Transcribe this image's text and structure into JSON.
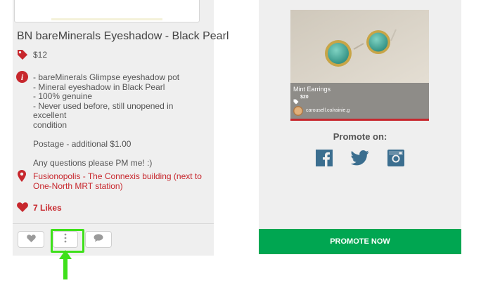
{
  "listing": {
    "title": "BN bareMinerals Eyeshadow - Black Pearl",
    "price": "$12",
    "description_lines": [
      "- bareMinerals Glimpse eyeshadow pot",
      "- Mineral eyeshadow in Black Pearl",
      "- 100% genuine",
      "- Never used before, still unopened in excellent",
      "condition",
      "",
      "Postage - additional $1.00",
      "",
      "Any questions please PM me! :)"
    ],
    "location_lines": [
      "Fusionopolis - The Connexis building (next to",
      "One-North MRT station)"
    ],
    "likes": "7 Likes"
  },
  "promo_card": {
    "item_name": "Mint Earrings",
    "price": "$20",
    "seller": "carousell.co/rainie.g"
  },
  "promote": {
    "heading": "Promote on:",
    "button_label": "PROMOTE NOW"
  },
  "colors": {
    "accent_red": "#c7272d",
    "promote_green": "#00a651",
    "highlight_green": "#3ee01a",
    "social_blue": "#3b6e8f"
  },
  "icons": [
    "tag-icon",
    "info-icon",
    "location-pin-icon",
    "heart-icon",
    "like-button-heart-icon",
    "more-vertical-icon",
    "comment-icon",
    "facebook-icon",
    "twitter-icon",
    "instagram-icon",
    "arrow-up-icon"
  ]
}
